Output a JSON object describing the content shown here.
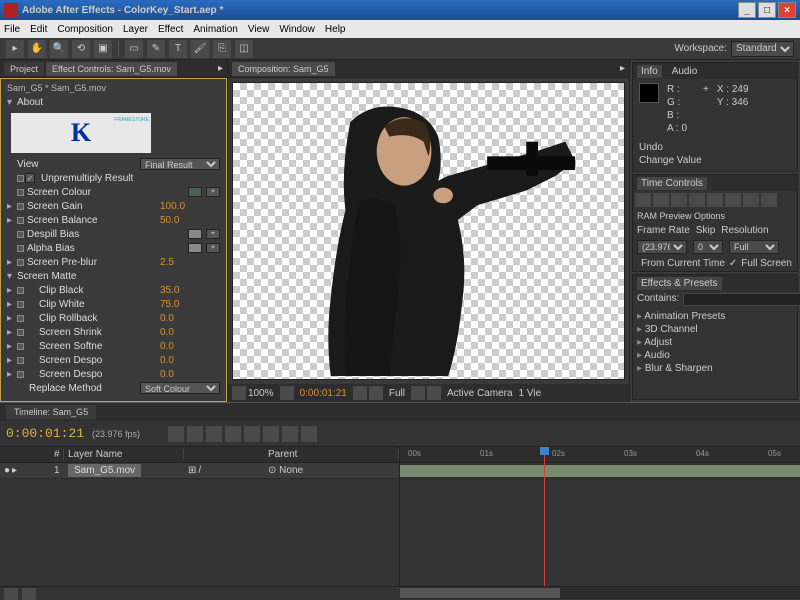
{
  "title": "Adobe After Effects - ColorKey_Start.aep *",
  "menu": [
    "File",
    "Edit",
    "Composition",
    "Layer",
    "Effect",
    "Animation",
    "View",
    "Window",
    "Help"
  ],
  "workspace": {
    "label": "Workspace:",
    "value": "Standard"
  },
  "tabs": {
    "project": "Project",
    "effect_controls": "Effect Controls: Sam_G5.mov"
  },
  "effect_header": "Sam_G5 * Sam_G5.mov",
  "sections": {
    "about": "About",
    "screen_matte": "Screen Matte"
  },
  "params": {
    "view": {
      "label": "View",
      "value": "Final Result"
    },
    "unpremult": {
      "label": "Unpremultiply Result",
      "checked": "✓"
    },
    "screen_colour": {
      "label": "Screen Colour"
    },
    "screen_gain": {
      "label": "Screen Gain",
      "value": "100.0"
    },
    "screen_balance": {
      "label": "Screen Balance",
      "value": "50.0"
    },
    "despill_bias": {
      "label": "Despill Bias"
    },
    "alpha_bias": {
      "label": "Alpha Bias"
    },
    "screen_preblur": {
      "label": "Screen Pre-blur",
      "value": "2.5"
    },
    "clip_black": {
      "label": "Clip Black",
      "value": "35.0"
    },
    "clip_white": {
      "label": "Clip White",
      "value": "75.0"
    },
    "clip_rollback": {
      "label": "Clip Rollback",
      "value": "0.0"
    },
    "screen_shrink": {
      "label": "Screen Shrink",
      "value": "0.0"
    },
    "screen_softne": {
      "label": "Screen Softne",
      "value": "0.0"
    },
    "screen_despo1": {
      "label": "Screen Despo",
      "value": "0.0"
    },
    "screen_despo2": {
      "label": "Screen Despo",
      "value": "0.0"
    },
    "replace_method": {
      "label": "Replace Method",
      "value": "Soft Colour"
    }
  },
  "comp_tab": "Composition: Sam_G5",
  "viewer_bar": {
    "zoom": "100%",
    "timecode": "0:00:01:21",
    "res": "Full",
    "camera": "Active Camera",
    "view": "1 Vie"
  },
  "info": {
    "tab1": "Info",
    "tab2": "Audio",
    "r": "R :",
    "g": "G :",
    "b": "B :",
    "a": "A : 0",
    "x": "X : 249",
    "y": "Y : 346",
    "undo": "Undo",
    "change": "Change Value"
  },
  "time_controls": {
    "title": "Time Controls",
    "ram": "RAM Preview Options",
    "frame_rate": "Frame Rate",
    "skip": "Skip",
    "resolution": "Resolution",
    "fr_val": "(23.976)",
    "skip_val": "0",
    "res_val": "Full",
    "from_current": "From Current Time",
    "full_screen": "Full Screen",
    "fs_checked": "✓"
  },
  "effects_presets": {
    "title": "Effects & Presets",
    "contains": "Contains:",
    "items": [
      "Animation Presets",
      "3D Channel",
      "Adjust",
      "Audio",
      "Blur & Sharpen"
    ]
  },
  "timeline": {
    "tab": "Timeline: Sam_G5",
    "timecode": "0:00:01:21",
    "fps": "(23.976 fps)",
    "cols": {
      "num": "#",
      "layer_name": "Layer Name",
      "parent": "Parent"
    },
    "row": {
      "num": "1",
      "name": "Sam_G5.mov",
      "parent": "None"
    },
    "ruler": [
      "00s",
      "01s",
      "02s",
      "03s",
      "04s",
      "05s"
    ]
  }
}
